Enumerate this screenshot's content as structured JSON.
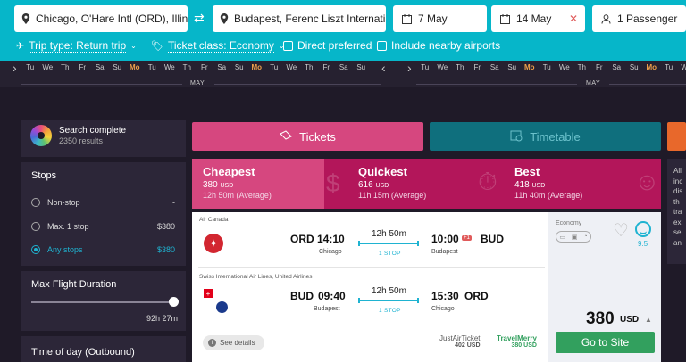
{
  "search": {
    "origin": "Chicago, O'Hare Intl (ORD), Illin...",
    "destination": "Budapest, Ferenc Liszt Internati...",
    "depart_date": "7 May",
    "return_date": "14 May",
    "passengers": "1 Passenger"
  },
  "options": {
    "trip_type": "Trip type: Return trip",
    "ticket_class": "Ticket class: Economy",
    "direct": "Direct preferred",
    "nearby": "Include nearby airports"
  },
  "date_strip": {
    "left_days": [
      "Tu",
      "We",
      "Th",
      "Fr",
      "Sa",
      "Su",
      "Mo",
      "Tu",
      "We",
      "Th",
      "Fr",
      "Sa",
      "Su",
      "Mo",
      "Tu",
      "We",
      "Th",
      "Fr",
      "Sa",
      "Su"
    ],
    "right_days": [
      "Tu",
      "We",
      "Th",
      "Fr",
      "Sa",
      "Su",
      "Mo",
      "Tu",
      "We",
      "Th",
      "Fr",
      "Sa",
      "Su",
      "Mo",
      "Tu",
      "We"
    ],
    "left_month": "MAY",
    "right_month": "MAY"
  },
  "sidebar": {
    "status_title": "Search complete",
    "status_count": "2350 results",
    "stops_heading": "Stops",
    "stops": [
      {
        "label": "Non-stop",
        "price": "-"
      },
      {
        "label": "Max. 1 stop",
        "price": "$380"
      },
      {
        "label": "Any stops",
        "price": "$380"
      }
    ],
    "duration_heading": "Max Flight Duration",
    "duration_value": "92h 27m",
    "time_heading": "Time of day (Outbound)"
  },
  "tabs": {
    "tickets": "Tickets",
    "timetable": "Timetable"
  },
  "sort": {
    "cheapest": {
      "title": "Cheapest",
      "price": "380",
      "currency": "USD",
      "avg": "12h 50m (Average)"
    },
    "quickest": {
      "title": "Quickest",
      "price": "616",
      "currency": "USD",
      "avg": "11h 15m (Average)"
    },
    "best": {
      "title": "Best",
      "price": "418",
      "currency": "USD",
      "avg": "11h 40m (Average)"
    }
  },
  "right_partial": "All inc dis th tra ex se an",
  "result": {
    "outbound": {
      "airline": "Air Canada",
      "from_code": "ORD",
      "from_time": "14:10",
      "from_city": "Chicago",
      "duration": "12h 50m",
      "stops": "1 STOP",
      "to_time": "10:00",
      "day_offset": "+1",
      "to_code": "BUD",
      "to_city": "Budapest"
    },
    "inbound": {
      "airline": "Swiss International Air Lines, United Airlines",
      "from_code": "BUD",
      "from_time": "09:40",
      "from_city": "Budapest",
      "duration": "12h 50m",
      "stops": "1 STOP",
      "to_time": "15:30",
      "to_code": "ORD",
      "to_city": "Chicago"
    },
    "see_details": "See details",
    "vendors": [
      {
        "name": "JustAirTicket",
        "price": "402 USD",
        "color": "#555555"
      },
      {
        "name": "TravelMerry",
        "price": "380 USD",
        "color": "#32a05e"
      }
    ],
    "cabin": "Economy",
    "rating": "9.5",
    "price": "380",
    "currency": "USD",
    "cta": "Go to Site"
  },
  "colors": {
    "accent": "#06b6c9",
    "pink": "#d6477f",
    "magenta": "#b3165a",
    "green": "#32a05e"
  }
}
